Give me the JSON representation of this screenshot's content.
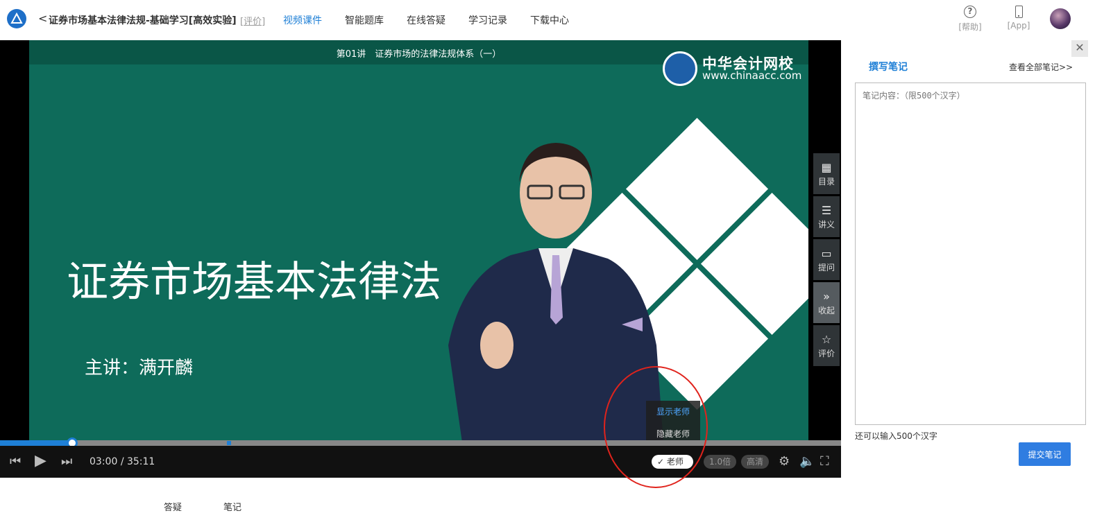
{
  "header": {
    "back_glyph": "<",
    "course_title": "证券市场基本法律法规-基础学习[高效实验]",
    "rate_link": "[评价]",
    "nav": [
      {
        "label": "视频课件",
        "active": true
      },
      {
        "label": "智能题库",
        "active": false
      },
      {
        "label": "在线答疑",
        "active": false
      },
      {
        "label": "学习记录",
        "active": false
      },
      {
        "label": "下载中心",
        "active": false
      }
    ],
    "help_label": "[帮助]",
    "app_label": "[App]"
  },
  "video": {
    "lecture_title": "第01讲　证券市场的法律法规体系（一）",
    "brand_name": "中华会计网校",
    "brand_url": "www.chinaacc.com",
    "slide_heading": "证券市场基本法律法",
    "slide_lecturer": "主讲：满开麟",
    "side_tools": [
      {
        "icon": "grid-icon",
        "glyph": "▦",
        "label": "目录"
      },
      {
        "icon": "list-icon",
        "glyph": "☰",
        "label": "讲义"
      },
      {
        "icon": "chat-icon",
        "glyph": "▭",
        "label": "提问"
      },
      {
        "icon": "double-chevron-icon",
        "glyph": "»",
        "label": "收起"
      },
      {
        "icon": "star-icon",
        "glyph": "☆",
        "label": "评价"
      }
    ],
    "teacher_menu": [
      "显示老师",
      "隐藏老师"
    ],
    "progress": {
      "current": "03:00",
      "separator": "/",
      "total": "35:11",
      "played_fraction": 0.0854
    },
    "teacher_toggle": "老师",
    "speed": "1.0倍",
    "quality": "高清"
  },
  "notes": {
    "tab_label": "撰写笔记",
    "view_all": "查看全部笔记>>",
    "placeholder": "笔记内容：（限500个汉字）",
    "remaining": "还可以输入500个汉字",
    "submit": "提交笔记"
  },
  "bottom_tabs": [
    "答疑",
    "笔记"
  ],
  "colors": {
    "accent": "#1e7fd6",
    "slide_bg": "#0e6b5a",
    "annotation": "#e0231c"
  }
}
